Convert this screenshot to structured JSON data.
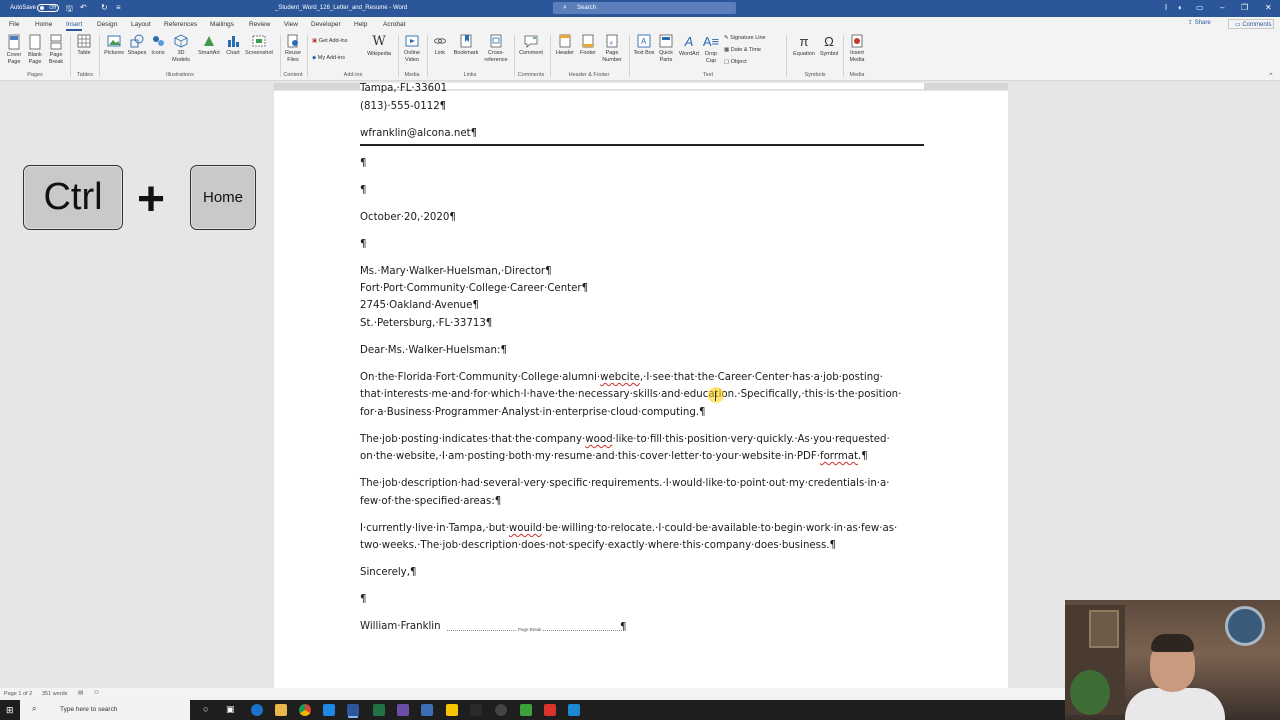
{
  "titlebar": {
    "autosave_label": "AutoSave",
    "autosave_state": "Off",
    "document_title": "_Student_Word_126_Letter_and_Resume  -  Word",
    "search_label": "Search"
  },
  "menu": {
    "tabs": [
      "File",
      "Home",
      "Insert",
      "Design",
      "Layout",
      "References",
      "Mailings",
      "Review",
      "View",
      "Developer",
      "Help",
      "Acrobat"
    ],
    "active_tab": "Insert",
    "share_label": "Share",
    "comments_label": "Comments"
  },
  "ribbon": {
    "buttons": {
      "cover_page": "Cover Page",
      "blank_page": "Blank Page",
      "page_break": "Page Break",
      "table": "Table",
      "pictures": "Pictures",
      "shapes": "Shapes",
      "icons": "Icons",
      "models_3d": "3D Models",
      "smartart": "SmartArt",
      "chart": "Chart",
      "screenshot": "Screenshot",
      "reuse_files": "Reuse Files",
      "get_addins": "Get Add-ins",
      "my_addins": "My Add-ins",
      "wikipedia": "Wikipedia",
      "online_video": "Online Video",
      "link": "Link",
      "bookmark": "Bookmark",
      "cross_reference": "Cross-reference",
      "comment": "Comment",
      "header": "Header",
      "footer": "Footer",
      "page_number": "Page Number",
      "text_box": "Text Box",
      "quick_parts": "Quick Parts",
      "wordart": "WordArt",
      "drop_cap": "Drop Cap",
      "signature_line": "Signature Line",
      "date_time": "Date & Time",
      "object": "Object",
      "equation": "Equation",
      "symbol": "Symbol",
      "insert_media": "Insert Media"
    },
    "groups": {
      "pages": "Pages",
      "tables": "Tables",
      "illustrations": "Illustrations",
      "content": "Content",
      "addins": "Add-ins",
      "media": "Media",
      "links": "Links",
      "comments": "Comments",
      "header_footer": "Header & Footer",
      "text": "Text",
      "symbols": "Symbols",
      "media2": "Media"
    }
  },
  "keys": {
    "ctrl": "Ctrl",
    "plus": "+",
    "home": "Home"
  },
  "document": {
    "address_partial": "Tampa,·FL·33601",
    "phone": "(813)·555-0112¶",
    "email": "wfranklin@alcona.net¶",
    "blank1": "¶",
    "blank2": "¶",
    "date": "October·20,·2020¶",
    "blank3": "¶",
    "recipient_name": "Ms.·Mary·Walker-Huelsman,·Director¶",
    "recipient_org": "Fort·Port·Community·College·Career·Center¶",
    "recipient_street": "2745·Oakland·Avenue¶",
    "recipient_city": "St.·Petersburg,·FL·33713¶",
    "salutation": "Dear·Ms.·Walker-Huelsman:¶",
    "p1_l1_a": "On·the·Florida·Fort·Community·College·alumni·",
    "p1_l1_err": "webcite",
    "p1_l1_b": ",·I·see·that·the·Career·Center·has·a·job·posting·",
    "p1_l2": "that·interests·me·and·for·which·I·have·the·necessary·skills·and·education.·Specifically,·this·is·the·position·",
    "p1_l3": "for·a·Business·Programmer·Analyst·in·enterprise·cloud·computing.¶",
    "p2_l1_a": "The·job·posting·indicates·that·the·company·",
    "p2_l1_err": "wood",
    "p2_l1_b": "·like·to·fill·this·position·very·quickly.·As·you·requested·",
    "p2_l2_a": "on·the·website,·I·am·posting·both·my·resume·and·this·cover·letter·to·your·website·in·PDF·",
    "p2_l2_err": "forrmat",
    "p2_l2_b": ".¶",
    "p3_l1": "The·job·description·had·several·very·specific·requirements.·I·would·like·to·point·out·my·credentials·in·a·",
    "p3_l2": "few·of·the·specified·areas:¶",
    "p4_l1_a": "I·currently·live·in·Tampa,·but·",
    "p4_l1_err": "wouild",
    "p4_l1_b": "·be·willing·to·relocate.·I·could·be·available·to·begin·work·in·as·few·as·",
    "p4_l2": "two·weeks.·The·job·description·does·not·specify·exactly·where·this·company·does·business.¶",
    "closing": "Sincerely,¶",
    "blank4": "¶",
    "signature": "William·Franklin",
    "page_break_label": "Page Break",
    "end_mark": "¶"
  },
  "status": {
    "page": "Page 1 of 2",
    "words": "351 words"
  },
  "taskbar": {
    "search_placeholder": "Type here to search"
  }
}
